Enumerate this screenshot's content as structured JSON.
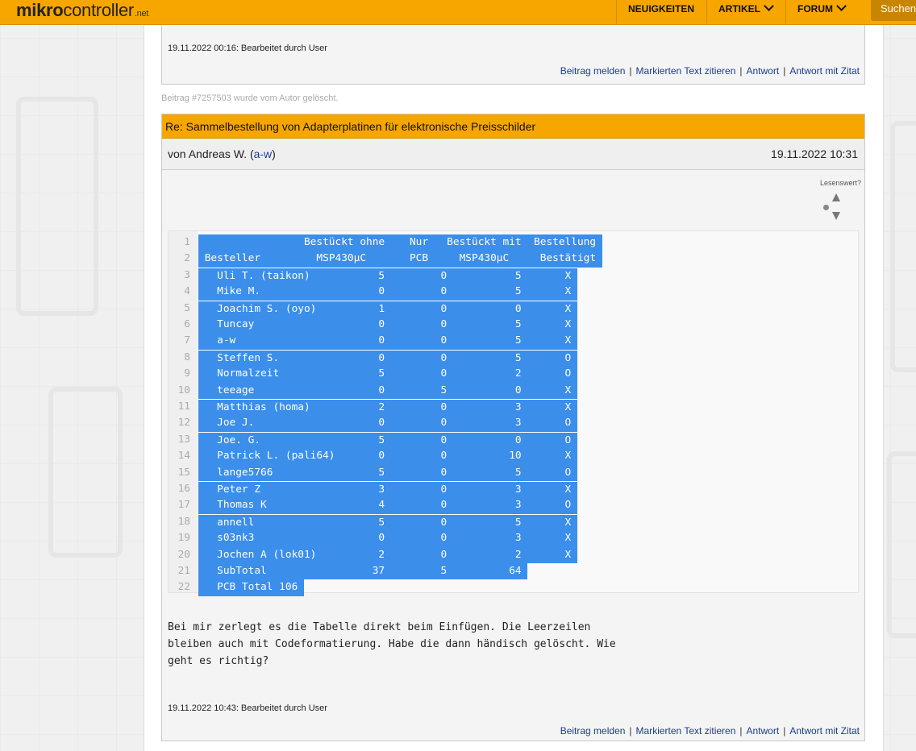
{
  "header": {
    "logo_bold": "mikro",
    "logo_rest": "controller",
    "logo_suffix": ".net",
    "nav": [
      "NEUIGKEITEN",
      "ARTIKEL",
      "FORUM"
    ],
    "search_label": "Suchen"
  },
  "prev_post": {
    "edited": "19.11.2022 00:16: Bearbeitet durch User",
    "actions": [
      "Beitrag melden",
      "Markierten Text zitieren",
      "Antwort",
      "Antwort mit Zitat"
    ]
  },
  "deleted_note": "Beitrag #7257503 wurde vom Autor gelöscht.",
  "post": {
    "title": "Re: Sammelbestellung von Adapterplatinen für elektronische Preisschilder",
    "author_prefix": "von Andreas W. (",
    "author_handle": "a-w",
    "author_suffix": ")",
    "date": "19.11.2022 10:31",
    "rating_label": "Lesenswert?",
    "code_lines": [
      {
        "n": "1",
        "text": "                 Bestückt ohne    Nur   Bestückt mit  Bestellung "
      },
      {
        "n": "2",
        "text": " Besteller         MSP430µC       PCB     MSP430µC     Bestätigt "
      },
      {
        "n": "3",
        "text": "   Uli T. (taikon)           5         0           5       X "
      },
      {
        "n": "4",
        "text": "   Mike M.                   0         0           5       X "
      },
      {
        "n": "5",
        "text": "   Joachim S. (oyo)          1         0           0       X "
      },
      {
        "n": "6",
        "text": "   Tuncay                    0         0           5       X "
      },
      {
        "n": "7",
        "text": "   a-w                       0         0           5       X "
      },
      {
        "n": "8",
        "text": "   Steffen S.                0         0           5       O "
      },
      {
        "n": "9",
        "text": "   Normalzeit                5         0           2       O "
      },
      {
        "n": "10",
        "text": "   teeage                    0         5           0       X "
      },
      {
        "n": "11",
        "text": "   Matthias (homa)           2         0           3       X "
      },
      {
        "n": "12",
        "text": "   Joe J.                    0         0           3       O "
      },
      {
        "n": "13",
        "text": "   Joe. G.                   5         0           0       O "
      },
      {
        "n": "14",
        "text": "   Patrick L. (pali64)       0         0          10       X "
      },
      {
        "n": "15",
        "text": "   lange5766                 5         0           5       O "
      },
      {
        "n": "16",
        "text": "   Peter Z                   3         0           3       X "
      },
      {
        "n": "17",
        "text": "   Thomas K                  4         0           3       O "
      },
      {
        "n": "18",
        "text": "   annell                    5         0           5       X "
      },
      {
        "n": "19",
        "text": "   s03nk3                    0         0           3       X "
      },
      {
        "n": "20",
        "text": "   Jochen A (lok01)          2         0           2       X "
      },
      {
        "n": "21",
        "text": "   SubTotal                 37         5          64 "
      },
      {
        "n": "22",
        "text": "   PCB Total 106 "
      }
    ],
    "body": "Bei mir zerlegt es die Tabelle direkt beim Einfügen. Die Leerzeilen\nbleiben auch mit Codeformatierung. Habe die dann händisch gelöscht. Wie\ngeht es richtig?",
    "edited": "19.11.2022 10:43: Bearbeitet durch User",
    "actions": [
      "Beitrag melden",
      "Markierten Text zitieren",
      "Antwort",
      "Antwort mit Zitat"
    ]
  },
  "colors": {
    "accent": "#f7a600",
    "selection": "#3b8eea",
    "link": "#1a3d8f"
  }
}
